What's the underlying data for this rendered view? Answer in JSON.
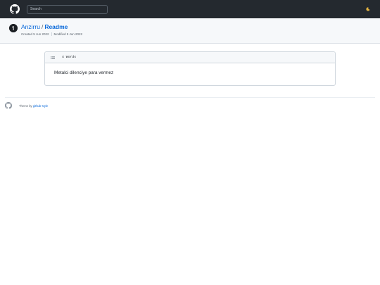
{
  "header": {
    "search_placeholder": "Search",
    "logo_icon": "github-icon",
    "theme_icon": "moon-icon"
  },
  "repo": {
    "owner": "Anzirru",
    "separator": "/",
    "name": "Readme",
    "created": "Created 5 Jun 2022",
    "modified": "Modified 5 Jun 2022"
  },
  "file": {
    "word_count": "4 Words",
    "content": "Metalci dilenciye para vermez"
  },
  "footer": {
    "theme_prefix": "Theme by",
    "theme_link": "github-style"
  },
  "colors": {
    "topbar": "#24292f",
    "link": "#0969da",
    "muted": "#57606a",
    "border": "#d0d7de",
    "header_bg": "#f6f8fa"
  }
}
